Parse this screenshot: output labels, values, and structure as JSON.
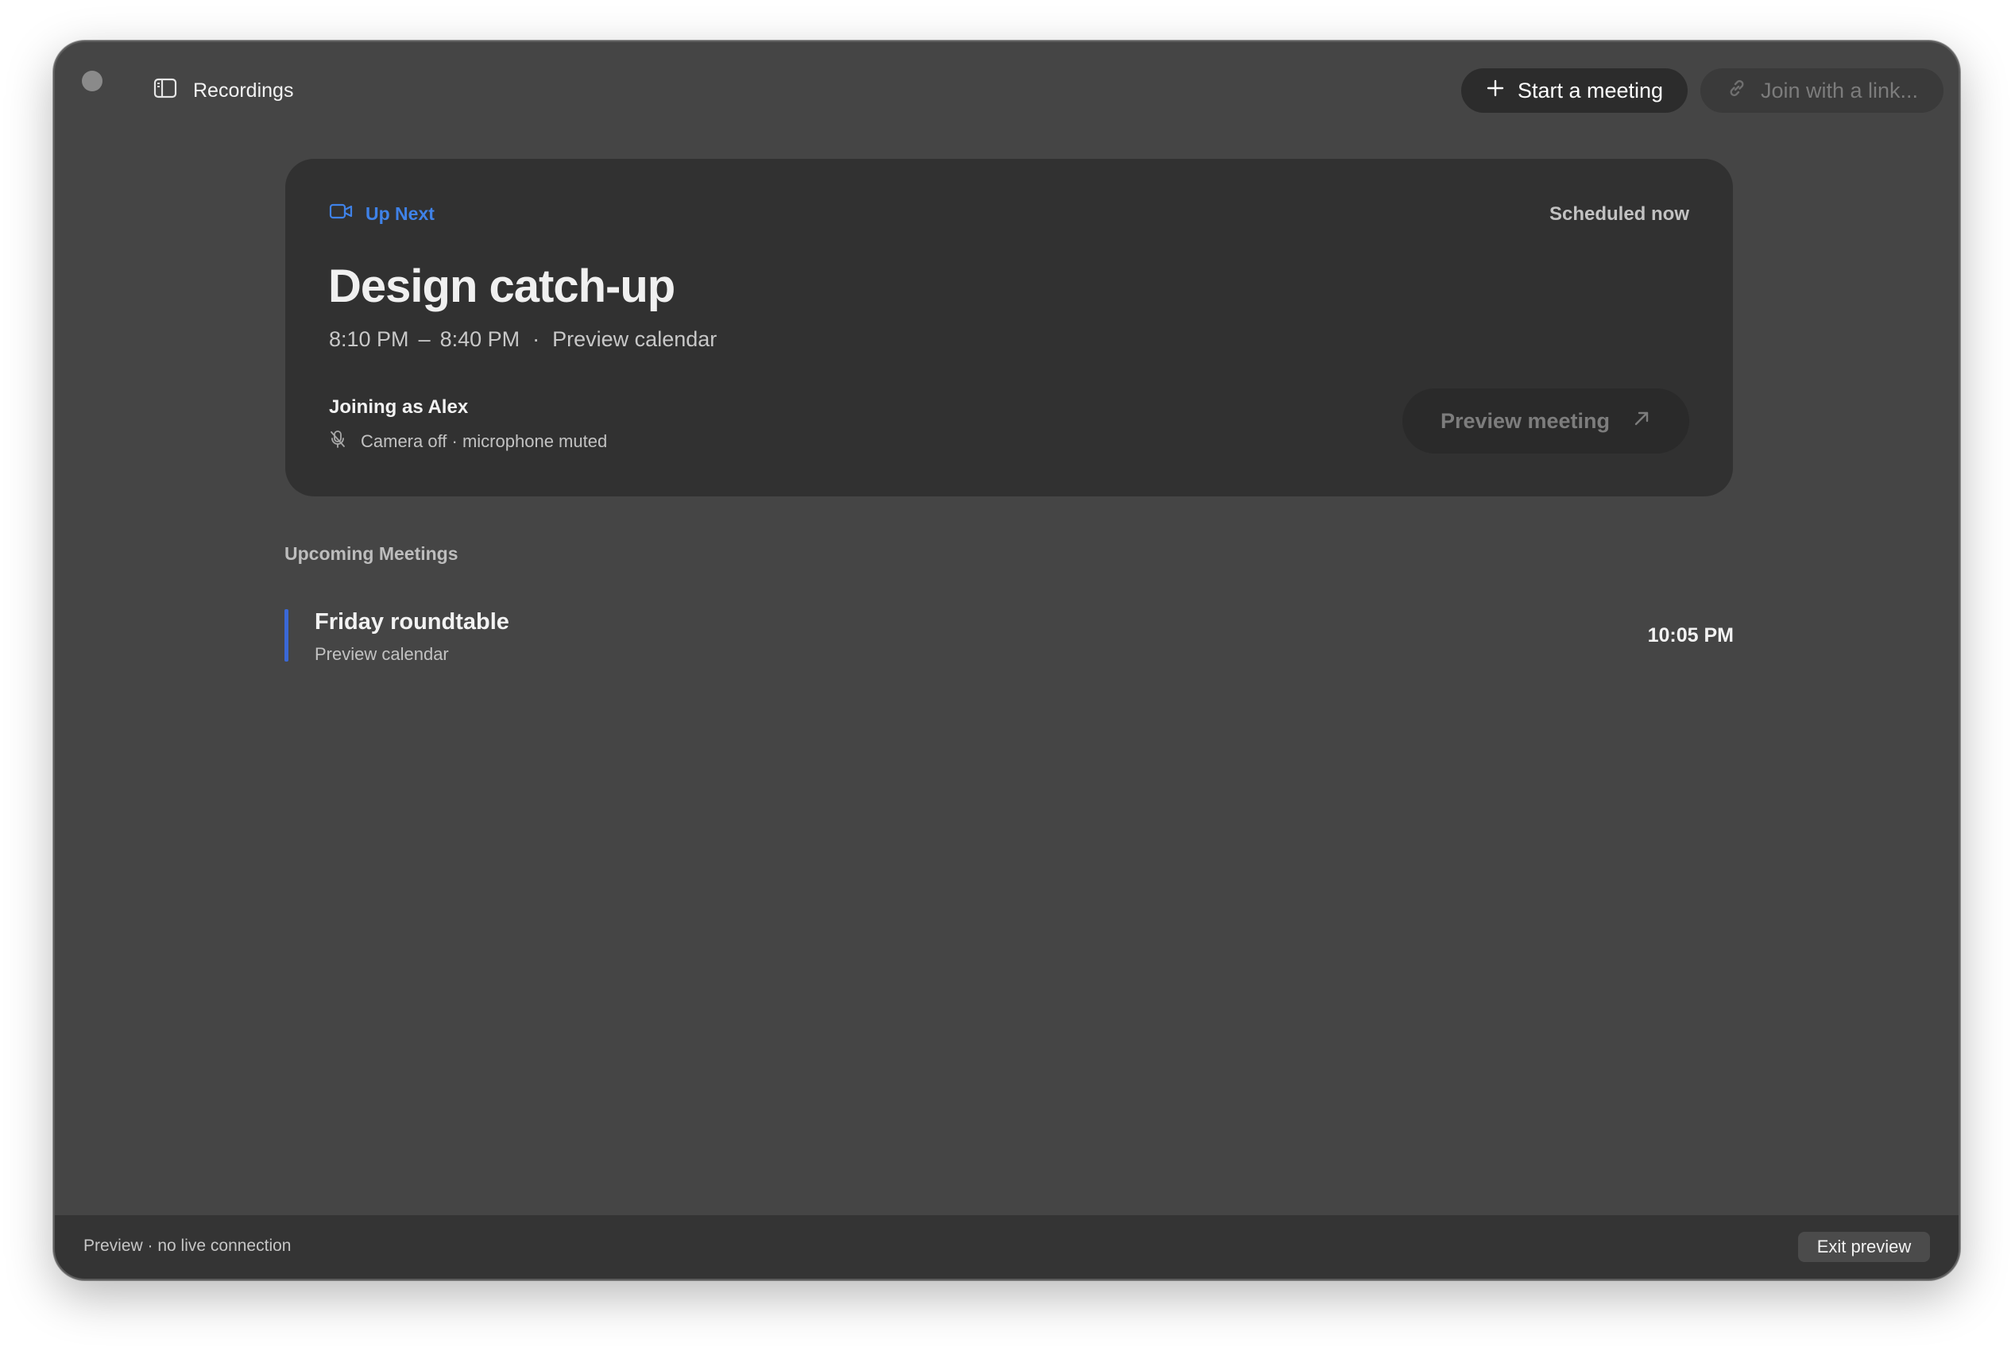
{
  "toolbar": {
    "recordings_label": "Recordings",
    "start_meeting_label": "Start a meeting",
    "join_link_label": "Join with a link..."
  },
  "up_next": {
    "label": "Up Next",
    "scheduled_status": "Scheduled now",
    "title": "Design catch-up",
    "start_time": "8:10 PM",
    "separator": "–",
    "end_time": "8:40 PM",
    "dot": "·",
    "calendar": "Preview calendar",
    "joining_as": "Joining as Alex",
    "device_status": "Camera off · microphone muted",
    "preview_button": "Preview meeting"
  },
  "upcoming": {
    "header": "Upcoming Meetings",
    "meetings": [
      {
        "name": "Friday roundtable",
        "calendar": "Preview calendar",
        "time": "10:05 PM"
      }
    ]
  },
  "footer": {
    "status": "Preview · no live connection",
    "exit_label": "Exit preview"
  },
  "colors": {
    "accent": "#3f82e8",
    "meeting_bar": "#3a68d6",
    "window_bg": "#454545",
    "card_bg": "#313131"
  },
  "icons": {
    "sidebar": "sidebar-icon",
    "plus": "plus-icon",
    "link": "link-icon",
    "video": "video-camera-icon",
    "mic_off": "microphone-off-icon",
    "arrow": "arrow-up-right-icon"
  }
}
